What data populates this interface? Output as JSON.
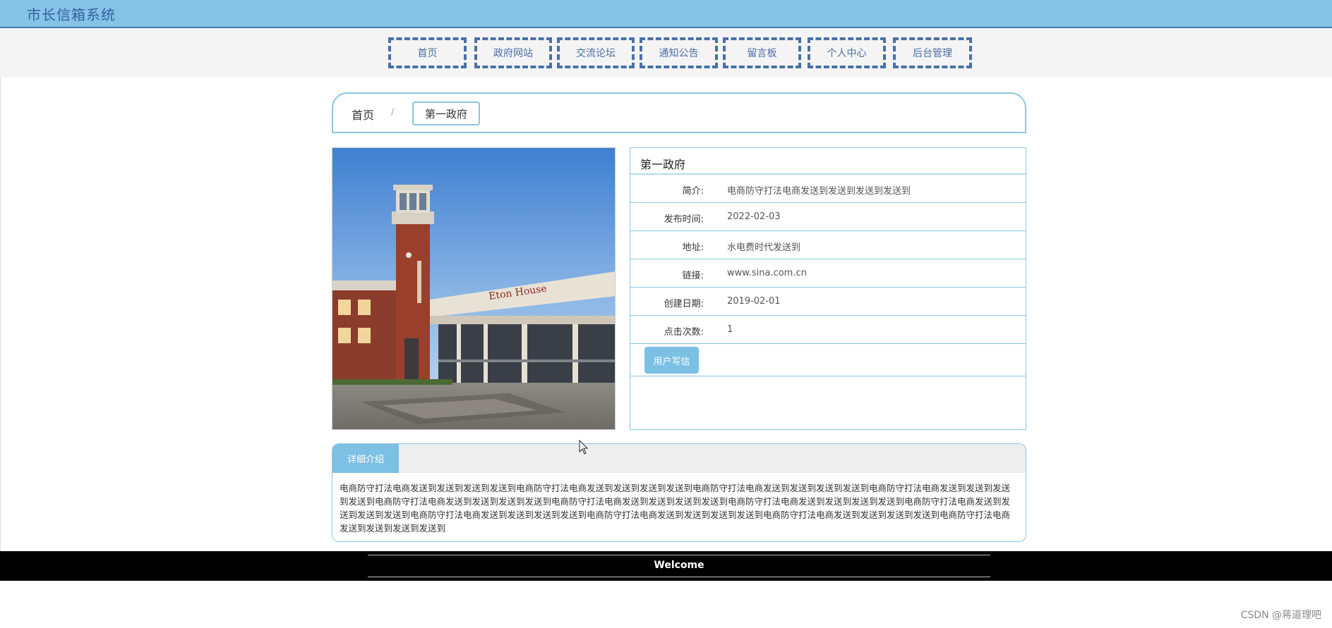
{
  "header": {
    "title": "市长信箱系统"
  },
  "nav": [
    {
      "label": "首页"
    },
    {
      "label": "政府网站"
    },
    {
      "label": "交流论坛"
    },
    {
      "label": "通知公告"
    },
    {
      "label": "留言板"
    },
    {
      "label": "个人中心"
    },
    {
      "label": "后台管理"
    }
  ],
  "breadcrumb": {
    "home": "首页",
    "separator": "/",
    "current": "第一政府"
  },
  "detail": {
    "title": "第一政府",
    "rows": [
      {
        "label": "简介:",
        "value": "电商防守打法电商发送到发送到发送到发送到"
      },
      {
        "label": "发布时间:",
        "value": "2022-02-03"
      },
      {
        "label": "地址:",
        "value": "水电费时代发送到"
      },
      {
        "label": "链接:",
        "value": "www.sina.com.cn"
      },
      {
        "label": "创建日期:",
        "value": "2019-02-01"
      },
      {
        "label": "点击次数:",
        "value": "1"
      }
    ],
    "write_button": "用户写信"
  },
  "photo": {
    "sign_text": "Eton House"
  },
  "intro": {
    "tab_label": "详细介绍",
    "text": "电商防守打法电商发送到发送到发送到发送到电商防守打法电商发送到发送到发送到发送到电商防守打法电商发送到发送到发送到发送到电商防守打法电商发送到发送到发送到发送到电商防守打法电商发送到发送到发送到发送到电商防守打法电商发送到发送到发送到发送到电商防守打法电商发送到发送到发送到发送到电商防守打法电商发送到发送到发送到发送到电商防守打法电商发送到发送到发送到发送到电商防守打法电商发送到发送到发送到发送到电商防守打法电商发送到发送到发送到发送到电商防守打法电商发送到发送到发送到发送到"
  },
  "footer": {
    "welcome": "Welcome"
  },
  "watermark": "CSDN @蒋道理吧",
  "colors": {
    "accent": "#7cc0e4",
    "header_bg": "#87c3e6",
    "nav_border": "#4a70a8"
  }
}
